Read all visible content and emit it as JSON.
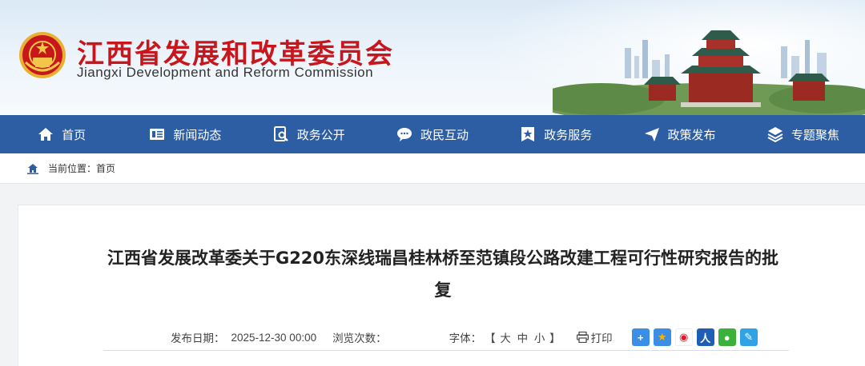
{
  "header": {
    "title_cn": "江西省发展和改革委员会",
    "title_en": "Jiangxi Development and Reform Commission"
  },
  "nav": [
    {
      "label": "首页",
      "icon": "home-icon"
    },
    {
      "label": "新闻动态",
      "icon": "news-icon"
    },
    {
      "label": "政务公开",
      "icon": "document-search-icon"
    },
    {
      "label": "政民互动",
      "icon": "chat-icon"
    },
    {
      "label": "政务服务",
      "icon": "star-badge-icon"
    },
    {
      "label": "政策发布",
      "icon": "send-icon"
    },
    {
      "label": "专题聚焦",
      "icon": "layers-icon"
    }
  ],
  "breadcrumb": {
    "prefix": "当前位置：",
    "current": "首页"
  },
  "article": {
    "title": "江西省发展改革委关于G220东深线瑞昌桂林桥至范镇段公路改建工程可行性研究报告的批复",
    "date_label": "发布日期：",
    "date": "2025-12-30 00:00",
    "views_label": "浏览次数：",
    "views": "",
    "font_label": "字体：",
    "font_open": "【",
    "font_large": "大",
    "font_medium": "中",
    "font_small": "小",
    "font_close": "】",
    "print_label": "打印"
  },
  "share": [
    {
      "icon": "plus-share-icon",
      "color": "#3a8ee6"
    },
    {
      "icon": "qzone-star-icon",
      "color": "#f5b400"
    },
    {
      "icon": "weibo-icon",
      "color": "#e6162d"
    },
    {
      "icon": "renren-icon",
      "color": "#1e5fb4"
    },
    {
      "icon": "wechat-icon",
      "color": "#3bb03b"
    },
    {
      "icon": "edit-share-icon",
      "color": "#2fa3e6"
    }
  ],
  "colors": {
    "nav_bg": "#2d5ea3",
    "brand_red": "#c8161d"
  }
}
